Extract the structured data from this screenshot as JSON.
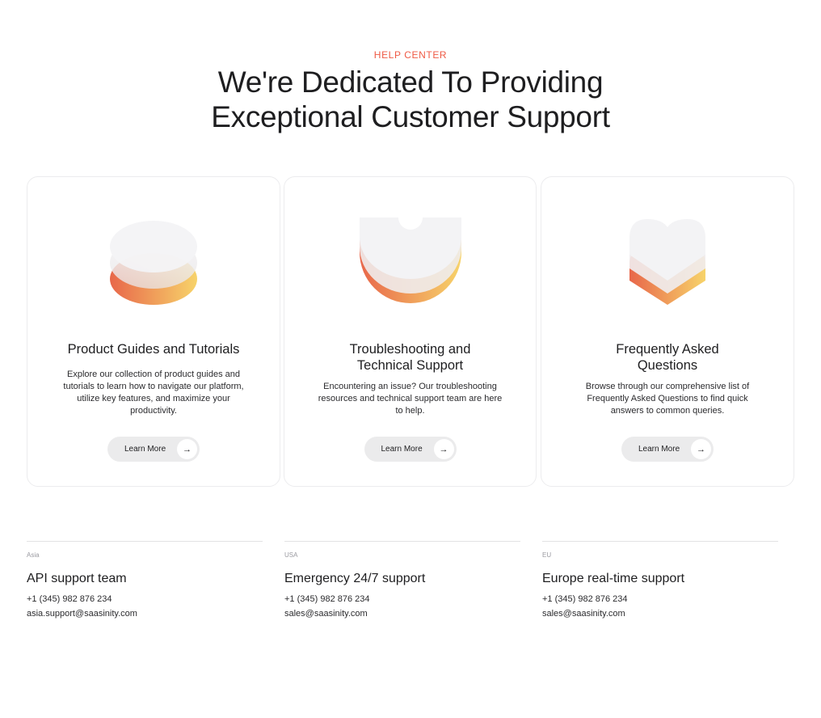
{
  "eyebrow": "HELP CENTER",
  "headline": "We're Dedicated To Providing Exceptional Customer Support",
  "colors": {
    "accent": "#ef5a45",
    "gradient_start": "#e8674a",
    "gradient_end": "#f7d36a",
    "button_bg": "#ebebec"
  },
  "cards": [
    {
      "icon": "stacked-layers-icon",
      "title": "Product Guides and Tutorials",
      "description": "Explore our collection of product guides and tutorials to learn how to navigate our platform, utilize key features, and maximize your productivity.",
      "button_label": "Learn More",
      "button_icon": "arrow-right-icon"
    },
    {
      "icon": "support-shield-icon",
      "title": "Troubleshooting and Technical Support",
      "description": "Encountering an issue? Our troubleshooting resources and technical support team are here to help.",
      "button_label": "Learn More",
      "button_icon": "arrow-right-icon"
    },
    {
      "icon": "stacked-heart-icon",
      "title": "Frequently Asked Questions",
      "description": "Browse through our comprehensive list of Frequently Asked Questions to find quick answers to common queries.",
      "button_label": "Learn More",
      "button_icon": "arrow-right-icon"
    }
  ],
  "contacts": [
    {
      "region": "Asia",
      "team": "API support team",
      "phone": "+1 (345) 982 876 234",
      "email": "asia.support@saasinity.com"
    },
    {
      "region": "USA",
      "team": "Emergency 24/7 support",
      "phone": "+1 (345) 982 876 234",
      "email": "sales@saasinity.com"
    },
    {
      "region": "EU",
      "team": "Europe real-time support",
      "phone": "+1 (345) 982 876 234",
      "email": "sales@saasinity.com"
    }
  ]
}
